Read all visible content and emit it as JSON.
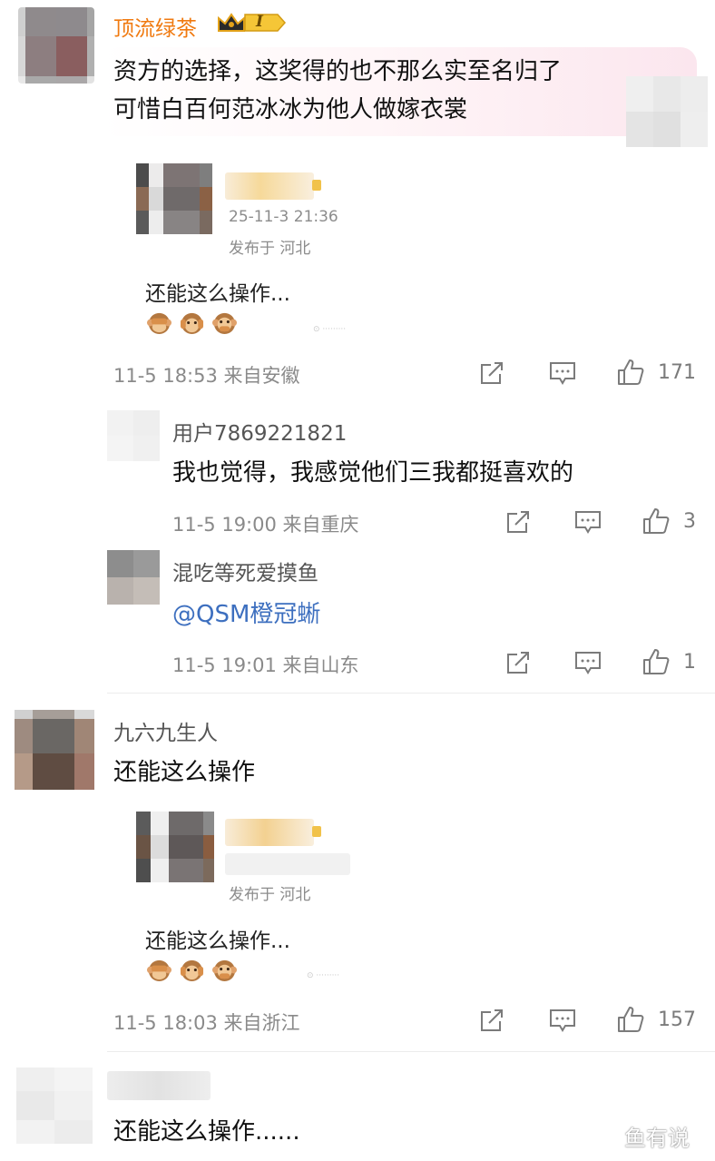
{
  "comments": [
    {
      "username": "顶流绿茶",
      "vip_level": "I",
      "lines": [
        "资方的选择，这奖得的也不那么实至名归了",
        "可惜白百何范冰冰为他人做嫁衣裳"
      ],
      "quoted_post": {
        "date": "25-11-3 21:36",
        "location": "发布于 河北",
        "text": "还能这么操作...",
        "emoji": [
          "see-no-evil-monkey",
          "hear-no-evil-monkey",
          "speak-no-evil-monkey"
        ]
      },
      "timestamp": "11-5 18:53 来自安徽",
      "likes": "171",
      "replies": [
        {
          "username": "用户7869221821",
          "text": "我也觉得，我感觉他们三我都挺喜欢的",
          "timestamp": "11-5 19:00 来自重庆",
          "likes": "3"
        },
        {
          "username": "混吃等死爱摸鱼",
          "text": "@QSM橙冠蜥",
          "timestamp": "11-5 19:01 来自山东",
          "likes": "1"
        }
      ]
    },
    {
      "username": "九六九生人",
      "text": "还能这么操作",
      "quoted_post": {
        "location": "发布于 河北",
        "text": "还能这么操作...",
        "emoji": [
          "see-no-evil-monkey",
          "hear-no-evil-monkey",
          "speak-no-evil-monkey"
        ]
      },
      "timestamp": "11-5 18:03 来自浙江",
      "likes": "157"
    },
    {
      "text": "还能这么操作......"
    }
  ],
  "watermark": "鱼有说",
  "colors": {
    "vip_name": "#f07a10",
    "mention": "#3d6fbf",
    "meta": "#8a8a8a"
  }
}
